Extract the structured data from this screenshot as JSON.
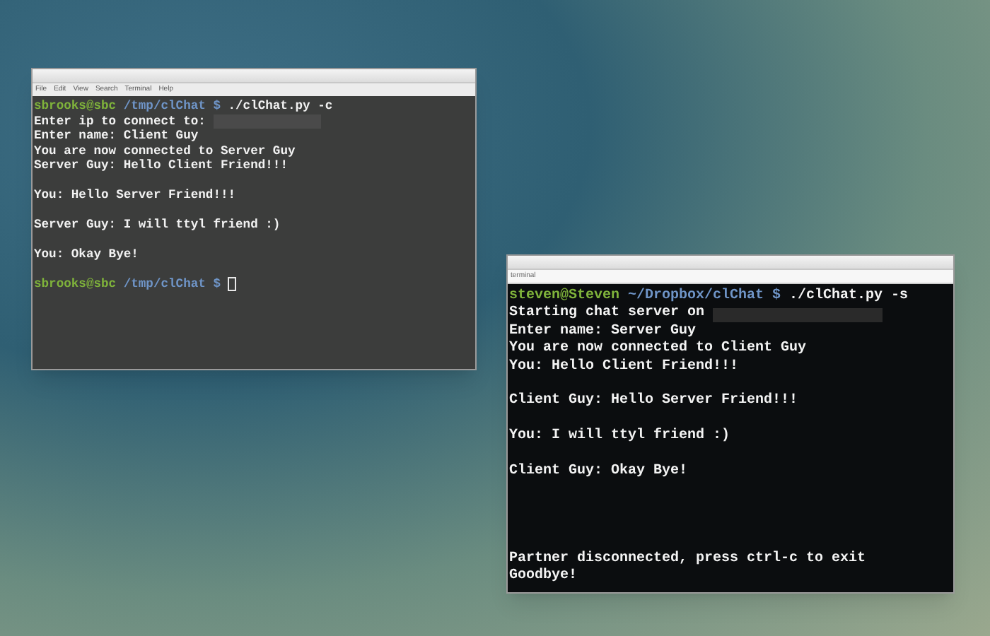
{
  "windows": [
    {
      "kind": "gray",
      "menu": [
        "File",
        "Edit",
        "View",
        "Search",
        "Terminal",
        "Help"
      ],
      "lines": [
        {
          "kind": "prompt",
          "user": "sbrooks@sbc",
          "path": "/tmp/clChat",
          "symbol": "$",
          "command": "./clChat.py -c",
          "cursor": false
        },
        {
          "kind": "text",
          "text": "Enter ip to connect to:",
          "redacted": true
        },
        {
          "kind": "text",
          "text": "Enter name: Client Guy",
          "redacted": false
        },
        {
          "kind": "text",
          "text": "You are now connected to Server Guy",
          "redacted": false
        },
        {
          "kind": "text",
          "text": "Server Guy: Hello Client Friend!!!",
          "redacted": false
        },
        {
          "kind": "blank"
        },
        {
          "kind": "text",
          "text": "You: Hello Server Friend!!!",
          "redacted": false
        },
        {
          "kind": "blank"
        },
        {
          "kind": "text",
          "text": "Server Guy: I will ttyl friend :)",
          "redacted": false
        },
        {
          "kind": "blank"
        },
        {
          "kind": "text",
          "text": "You: Okay Bye!",
          "redacted": false
        },
        {
          "kind": "blank"
        },
        {
          "kind": "prompt",
          "user": "sbrooks@sbc",
          "path": "/tmp/clChat",
          "symbol": "$",
          "cursor": true
        }
      ]
    },
    {
      "kind": "black",
      "title": "terminal",
      "lines": [
        {
          "kind": "prompt",
          "user": "steven@Steven",
          "path": "~/Dropbox/clChat",
          "symbol": "$",
          "command": "./clChat.py -s",
          "cursor": false
        },
        {
          "kind": "text",
          "text": "Starting chat server on",
          "redacted": true
        },
        {
          "kind": "text",
          "text": "Enter name: Server Guy",
          "redacted": false
        },
        {
          "kind": "text",
          "text": "You are now connected to Client Guy",
          "redacted": false
        },
        {
          "kind": "text",
          "text": "You: Hello Client Friend!!!",
          "redacted": false
        },
        {
          "kind": "blank"
        },
        {
          "kind": "text",
          "text": "Client Guy: Hello Server Friend!!!",
          "redacted": false
        },
        {
          "kind": "blank"
        },
        {
          "kind": "text",
          "text": "You: I will ttyl friend :)",
          "redacted": false
        },
        {
          "kind": "blank"
        },
        {
          "kind": "text",
          "text": "Client Guy: Okay Bye!",
          "redacted": false
        },
        {
          "kind": "blank"
        },
        {
          "kind": "blank"
        },
        {
          "kind": "blank"
        },
        {
          "kind": "blank"
        },
        {
          "kind": "text",
          "text": "Partner disconnected, press ctrl-c to exit",
          "redacted": false
        },
        {
          "kind": "text",
          "text": "Goodbye!",
          "redacted": false
        }
      ]
    }
  ]
}
